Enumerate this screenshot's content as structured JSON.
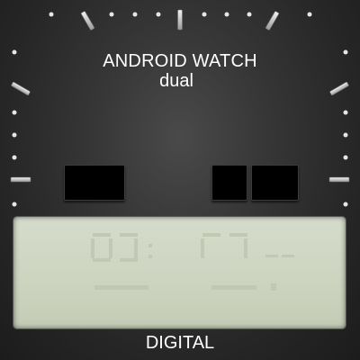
{
  "watch": {
    "brand_title": "ANDROID WATCH",
    "brand_subtitle": "dual",
    "footer_label": "DIGITAL"
  },
  "colors": {
    "text": "#ffffff",
    "lcd_background": "#cfd5c2",
    "lcd_ghost_segment": "#bfc6b1",
    "subdial_box": "#000000",
    "tick_marks": "#d8d8d8"
  },
  "icons": [
    "hour-marker-icon",
    "minute-dot-icon"
  ]
}
